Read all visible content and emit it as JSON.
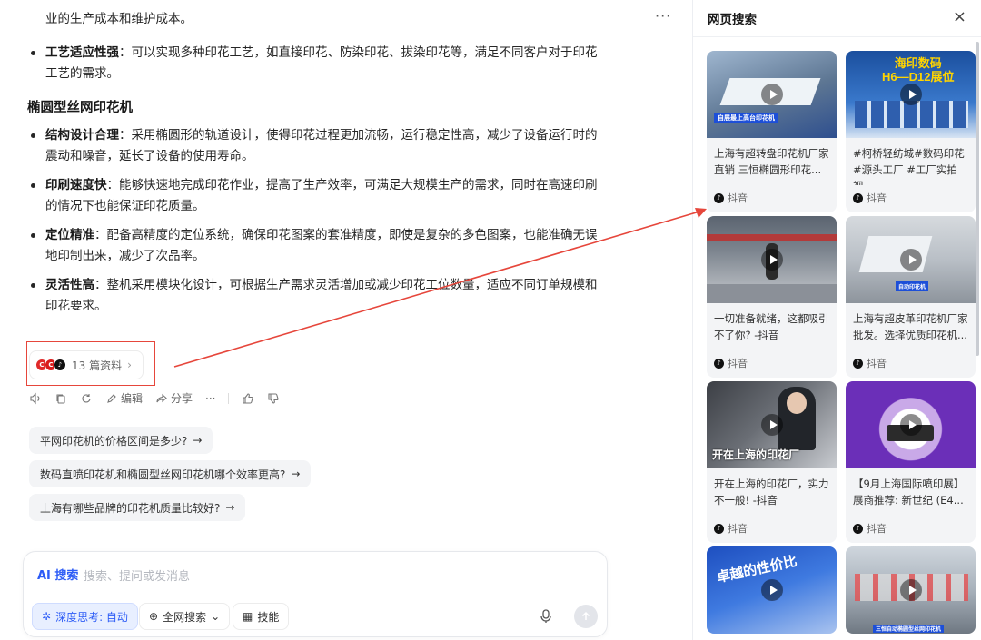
{
  "chat": {
    "top_partial": "业的生产成本和维护成本。",
    "bullets_a": [
      {
        "title": "工艺适应性强",
        "text": "：可以实现多种印花工艺，如直接印花、防染印花、拔染印花等，满足不同客户对于印花工艺的需求。"
      }
    ],
    "section_title": "椭圆型丝网印花机",
    "bullets_b": [
      {
        "title": "结构设计合理",
        "text": "：采用椭圆形的轨道设计，使得印花过程更加流畅，运行稳定性高，减少了设备运行时的震动和噪音，延长了设备的使用寿命。"
      },
      {
        "title": "印刷速度快",
        "text": "：能够快速地完成印花作业，提高了生产效率，可满足大规模生产的需求，同时在高速印刷的情况下也能保证印花质量。"
      },
      {
        "title": "定位精准",
        "text": "：配备高精度的定位系统，确保印花图案的套准精度，即使是复杂的多色图案，也能准确无误地印制出来，减少了次品率。"
      },
      {
        "title": "灵活性高",
        "text": "：整机采用模块化设计，可根据生产需求灵活增加或减少印花工位数量，适应不同订单规模和印花要求。"
      }
    ],
    "sources_label": "13 篇资料",
    "toolbar": {
      "edit": "编辑",
      "share": "分享",
      "more": "···"
    },
    "suggestions": [
      "平网印花机的价格区间是多少?",
      "数码直喷印花机和椭圆型丝网印花机哪个效率更高?",
      "上海有哪些品牌的印花机质量比较好?"
    ],
    "input": {
      "ai_label": "AI 搜索",
      "placeholder": "搜索、提问或发消息",
      "deep_think": "深度思考: 自动",
      "web_search": "全网搜索",
      "skills": "技能"
    },
    "more_menu": "···"
  },
  "panel": {
    "title": "网页搜索",
    "close": "×",
    "cards": [
      {
        "title": "上海有超转盘印花机厂家直销 三恒椭圆形印花...",
        "source": "抖音",
        "thumb_text": "自展最上高台印花机"
      },
      {
        "title": "#柯桥轻纺城#数码印花 #源头工厂 #工厂实拍视...",
        "source": "抖音",
        "thumb_text": "海印数码\nH6—D12展位"
      },
      {
        "title": "一切准备就绪，这都吸引不了你? -抖音",
        "source": "抖音",
        "thumb_text": ""
      },
      {
        "title": "上海有超皮革印花机厂家批发。选择优质印花机...",
        "source": "抖音",
        "thumb_text": "自动印花机"
      },
      {
        "title": "开在上海的印花厂，实力不一般! -抖音",
        "source": "抖音",
        "thumb_text": "开在上海的印花厂"
      },
      {
        "title": "【9月上海国际喷印展】展商推荐: 新世纪 (E4...",
        "source": "抖音",
        "thumb_text": ""
      },
      {
        "title": "",
        "source": "",
        "thumb_text": "卓越的性价比"
      },
      {
        "title": "",
        "source": "",
        "thumb_text": "三恒自动椭圆型丝网印花机"
      }
    ]
  },
  "colors": {
    "accent": "#2d5cf6",
    "annotation": "#e6463b",
    "douyin": "#111111"
  }
}
